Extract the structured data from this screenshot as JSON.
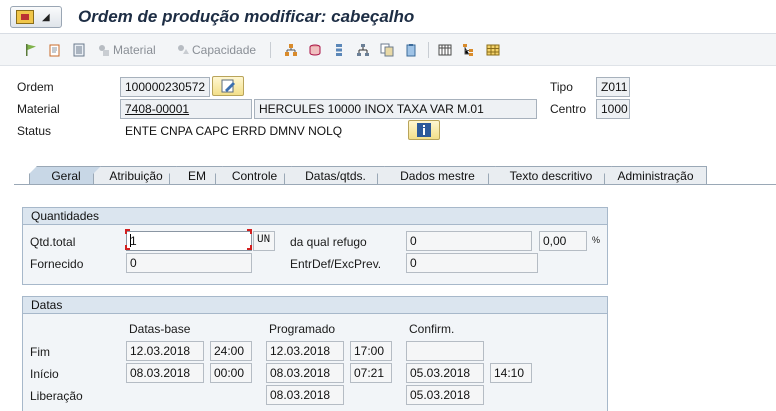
{
  "title": "Ordem de produção modificar: cabeçalho",
  "toolbar": {
    "material_label": "Material",
    "capacidade_label": "Capacidade",
    "icons": [
      "flag-icon",
      "copy-icon",
      "list-icon",
      "material-icon",
      "capacity-icon",
      "hierarchy-icon",
      "cylinder-icon",
      "vertical-list-icon",
      "org-chart-icon",
      "documents-icon",
      "clipboard-icon",
      "table-icon",
      "tree-icon",
      "grid-icon"
    ]
  },
  "header": {
    "ordem_label": "Ordem",
    "ordem_value": "100000230572",
    "material_label": "Material",
    "material_value": "7408-00001",
    "material_desc": "HERCULES 10000 INOX TAXA VAR M.01",
    "status_label": "Status",
    "status_value": "ENTE CNPA CAPC ERRD DMNV NOLQ",
    "tipo_label": "Tipo",
    "tipo_value": "Z011",
    "centro_label": "Centro",
    "centro_value": "1000"
  },
  "tabs": [
    "Geral",
    "Atribuição",
    "EM",
    "Controle",
    "Datas/qtds.",
    "Dados mestre",
    "Texto descritivo",
    "Administração"
  ],
  "quantidades": {
    "title": "Quantidades",
    "qtd_total_label": "Qtd.total",
    "qtd_total_value": "1",
    "unit": "UN",
    "refugo_label": "da qual refugo",
    "refugo_value": "0",
    "refugo_pct": "0,00",
    "pct_sign": "%",
    "fornecido_label": "Fornecido",
    "fornecido_value": "0",
    "entrdef_label": "EntrDef/ExcPrev.",
    "entrdef_value": "0"
  },
  "datas": {
    "title": "Datas",
    "col_base": "Datas-base",
    "col_prog": "Programado",
    "col_conf": "Confirm.",
    "fim_label": "Fim",
    "inicio_label": "Início",
    "liberacao_label": "Liberação",
    "fim": {
      "base_date": "12.03.2018",
      "base_time": "24:00",
      "prog_date": "12.03.2018",
      "prog_time": "17:00",
      "conf_date": ""
    },
    "inicio": {
      "base_date": "08.03.2018",
      "base_time": "00:00",
      "prog_date": "08.03.2018",
      "prog_time": "07:21",
      "conf_date": "05.03.2018",
      "conf_time": "14:10"
    },
    "liberacao": {
      "prog_date": "08.03.2018",
      "conf_date": "05.03.2018"
    }
  },
  "colors": {
    "accent": "#1d2d44",
    "tab_active": "#c8d7e6",
    "group_head": "#dbe5ef"
  }
}
